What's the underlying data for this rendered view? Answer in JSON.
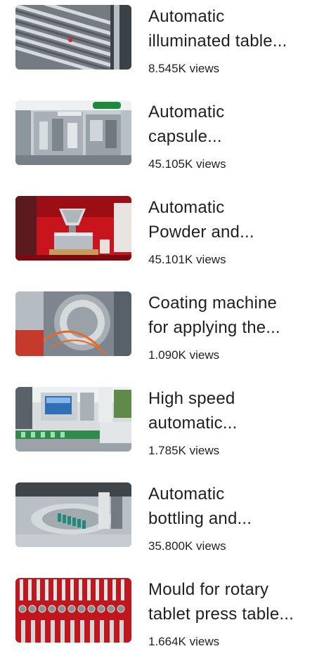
{
  "videos": [
    {
      "title_line1": "Automatic",
      "title_line2": "illuminated table...",
      "views": "8.545K views",
      "thumbnail_subject": "illuminated-table-rollers"
    },
    {
      "title_line1": "Automatic",
      "title_line2": "capsule...",
      "views": "45.105K views",
      "thumbnail_subject": "capsule-filling-machine"
    },
    {
      "title_line1": "Automatic",
      "title_line2": "Powder and...",
      "views": "45.101K views",
      "thumbnail_subject": "powder-hopper-machine"
    },
    {
      "title_line1": "Coating machine",
      "title_line2": "for applying the...",
      "views": "1.090K views",
      "thumbnail_subject": "coating-drum"
    },
    {
      "title_line1": "High speed",
      "title_line2": "automatic...",
      "views": "1.785K views",
      "thumbnail_subject": "packaging-line-with-screen"
    },
    {
      "title_line1": "Automatic",
      "title_line2": "bottling and...",
      "views": "35.800K views",
      "thumbnail_subject": "bottling-turntable"
    },
    {
      "title_line1": "Mould for rotary",
      "title_line2": "tablet press table...",
      "views": "1.664K views",
      "thumbnail_subject": "tablet-press-moulds"
    }
  ]
}
